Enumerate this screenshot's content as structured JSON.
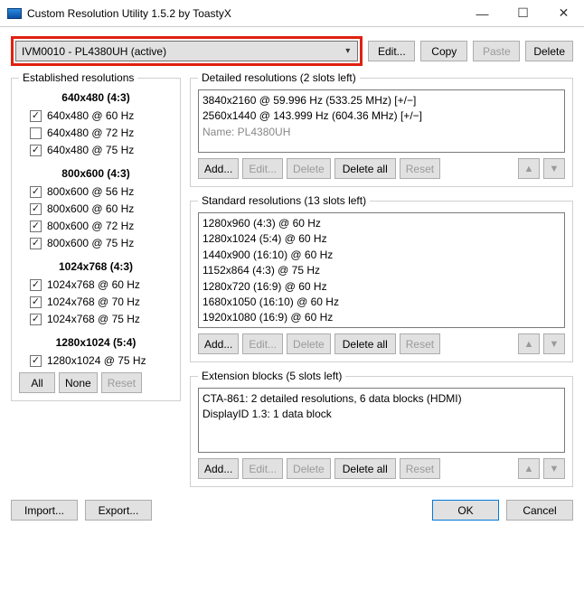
{
  "window": {
    "title": "Custom Resolution Utility 1.5.2 by ToastyX"
  },
  "topbar": {
    "selected_display": "IVM0010 - PL4380UH (active)",
    "edit": "Edit...",
    "copy": "Copy",
    "paste": "Paste",
    "delete": "Delete"
  },
  "established": {
    "legend": "Established resolutions",
    "groups": [
      {
        "header": "640x480 (4:3)",
        "items": [
          {
            "label": "640x480 @ 60 Hz",
            "checked": true
          },
          {
            "label": "640x480 @ 72 Hz",
            "checked": false
          },
          {
            "label": "640x480 @ 75 Hz",
            "checked": true
          }
        ]
      },
      {
        "header": "800x600 (4:3)",
        "items": [
          {
            "label": "800x600 @ 56 Hz",
            "checked": true
          },
          {
            "label": "800x600 @ 60 Hz",
            "checked": true
          },
          {
            "label": "800x600 @ 72 Hz",
            "checked": true
          },
          {
            "label": "800x600 @ 75 Hz",
            "checked": true
          }
        ]
      },
      {
        "header": "1024x768 (4:3)",
        "items": [
          {
            "label": "1024x768 @ 60 Hz",
            "checked": true
          },
          {
            "label": "1024x768 @ 70 Hz",
            "checked": true
          },
          {
            "label": "1024x768 @ 75 Hz",
            "checked": true
          }
        ]
      },
      {
        "header": "1280x1024 (5:4)",
        "items": [
          {
            "label": "1280x1024 @ 75 Hz",
            "checked": true
          }
        ]
      }
    ],
    "all": "All",
    "none": "None",
    "reset": "Reset"
  },
  "detailed": {
    "legend": "Detailed resolutions (2 slots left)",
    "lines": [
      "3840x2160 @ 59.996 Hz (533.25 MHz) [+/−]",
      "2560x1440 @ 143.999 Hz (604.36 MHz) [+/−]"
    ],
    "name_label": "Name: PL4380UH"
  },
  "standard": {
    "legend": "Standard resolutions (13 slots left)",
    "lines": [
      "1280x960 (4:3) @ 60 Hz",
      "1280x1024 (5:4) @ 60 Hz",
      "1440x900 (16:10) @ 60 Hz",
      "1152x864 (4:3) @ 75 Hz",
      "1280x720 (16:9) @ 60 Hz",
      "1680x1050 (16:10) @ 60 Hz",
      "1920x1080 (16:9) @ 60 Hz"
    ]
  },
  "extension": {
    "legend": "Extension blocks (5 slots left)",
    "lines": [
      "CTA-861: 2 detailed resolutions, 6 data blocks (HDMI)",
      "DisplayID 1.3: 1 data block"
    ]
  },
  "panel_btn": {
    "add": "Add...",
    "edit": "Edit...",
    "delete": "Delete",
    "delete_all": "Delete all",
    "reset": "Reset"
  },
  "bottom": {
    "import": "Import...",
    "export": "Export...",
    "ok": "OK",
    "cancel": "Cancel"
  }
}
